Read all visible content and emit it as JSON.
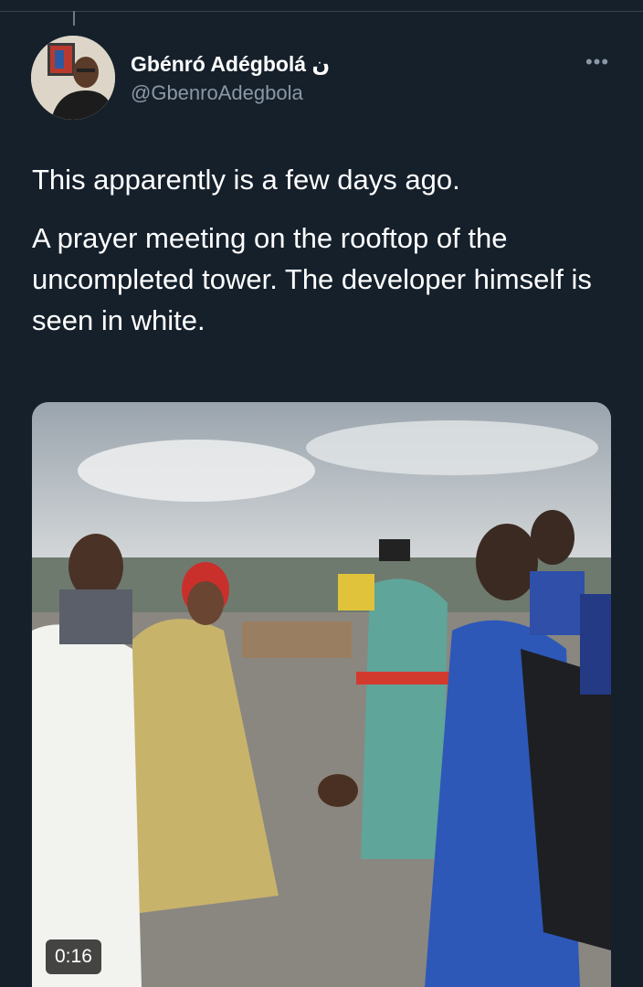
{
  "tweet": {
    "author_name": "Gbénró Adégbolá ن",
    "handle": "@GbenroAdegbola",
    "more_icon": "ellipsis-icon",
    "paragraphs": [
      "This apparently is a few days ago.",
      "A prayer meeting on the rooftop of the uncompleted tower. The developer himself is seen in white."
    ]
  },
  "media": {
    "type": "video",
    "duration": "0:16"
  },
  "colors": {
    "background": "#15202b",
    "primary_text": "#ffffff",
    "secondary_text": "#8b98a5",
    "divider": "#38444d"
  }
}
